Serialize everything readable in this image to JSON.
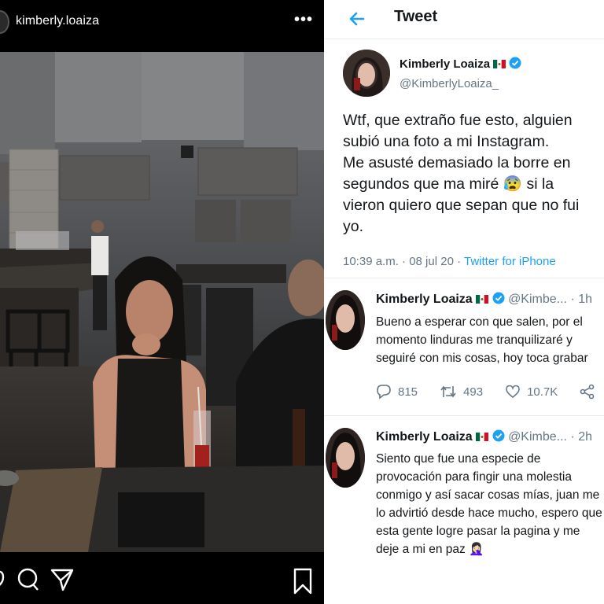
{
  "instagram": {
    "username": "kimberly.loaiza",
    "more_label": "•••"
  },
  "twitter": {
    "title": "Tweet",
    "main_tweet": {
      "name": "Kimberly Loaiza",
      "handle": "@KimberlyLoaiza_",
      "text": "Wtf, que extraño fue esto, alguien\nsubió una foto a mi Instagram.\nMe asusté demasiado la borre en\nsegundos que ma miré 😰 si la\nvieron quiero que sepan que no fui\nyo.",
      "time": "10:39 a.m. · 08 jul 20 · ",
      "source": "Twitter for iPhone"
    },
    "replies": [
      {
        "name": "Kimberly Loaiza",
        "handle": "@Kimbe...",
        "time": "· 1h",
        "text": "Bueno a esperar con que salen, por el\nmomento linduras me tranquilizaré y\nseguiré con mis cosas, hoy toca grabar",
        "replies_count": "815",
        "retweets": "493",
        "likes": "10.7K"
      },
      {
        "name": "Kimberly Loaiza",
        "handle": "@Kimbe...",
        "time": "· 2h",
        "text": "Siento que fue una especie de\nprovocación para fingir una molestia\nconmigo y así sacar cosas mías, juan me\nlo advirtió desde hace mucho, espero que\nesta gente logre pasar la pagina y me\ndeje a mi en paz 🤦🏻‍♀️"
      }
    ]
  },
  "colors": {
    "twitter_blue": "#1da1f2",
    "instagram_bg": "#000000",
    "text_dark": "#14171a",
    "text_gray": "#657786"
  },
  "icons": [
    "more-icon",
    "comment-icon",
    "share-icon",
    "bookmark-icon",
    "back-arrow-icon",
    "verified-icon",
    "mexico-flag-icon",
    "reply-icon",
    "retweet-icon",
    "like-icon",
    "tweet-share-icon"
  ]
}
